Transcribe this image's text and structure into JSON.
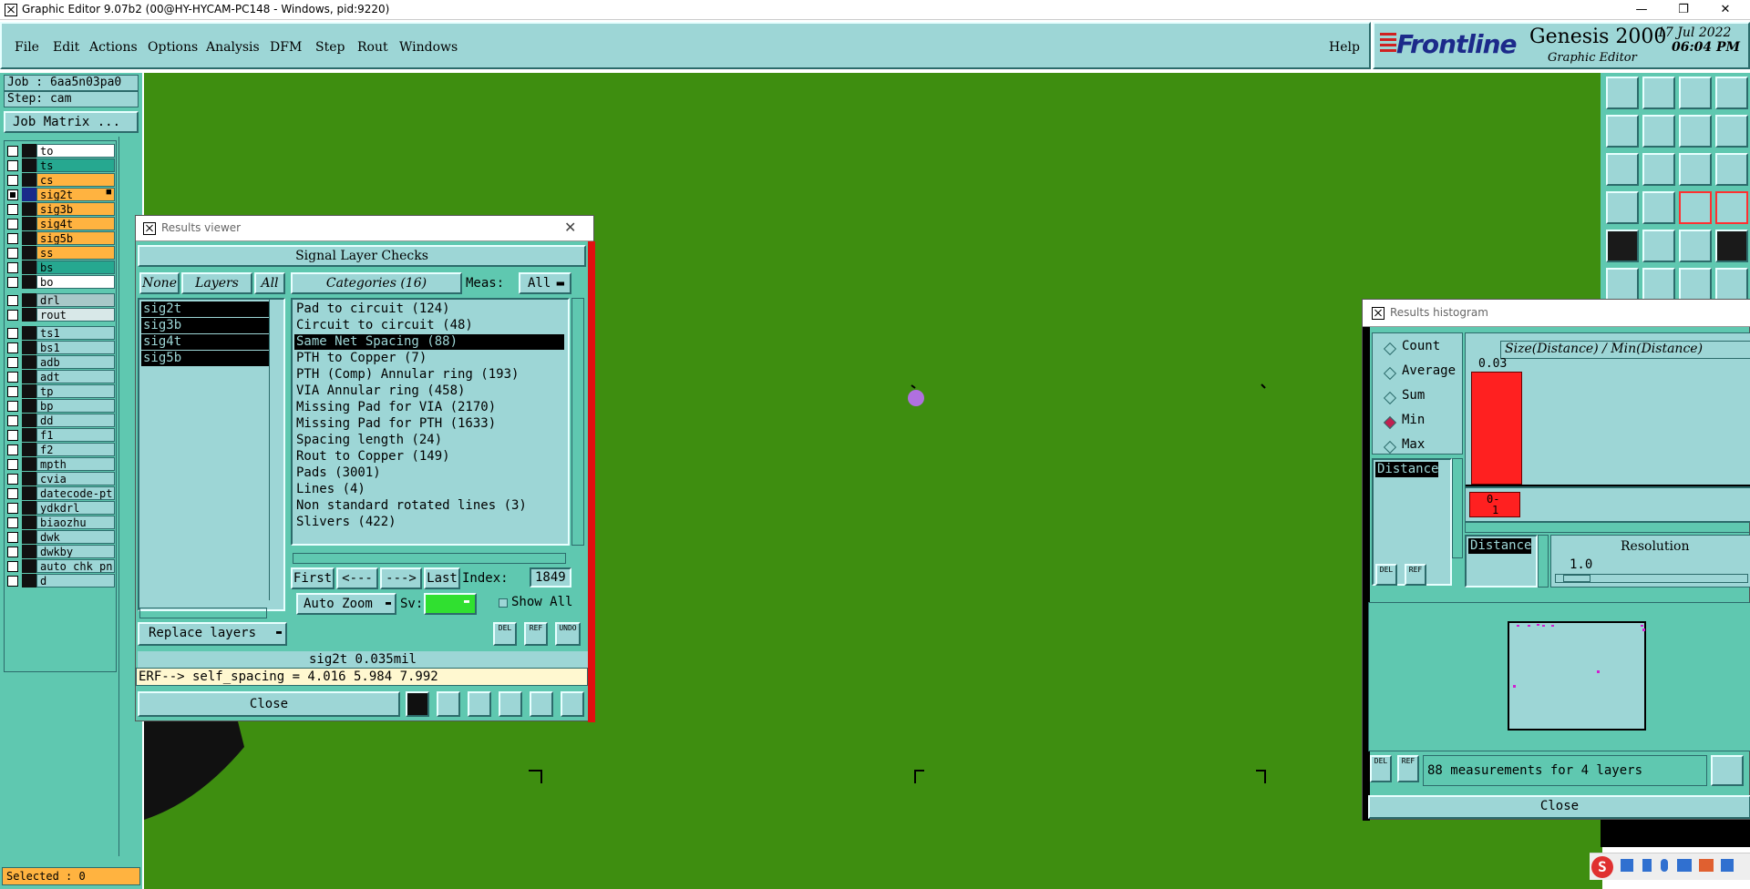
{
  "window": {
    "title": "Graphic Editor 9.07b2 (00@HY-HYCAM-PC148 - Windows, pid:9220)"
  },
  "menu": [
    "File",
    "Edit",
    "Actions",
    "Options",
    "Analysis",
    "DFM",
    "Step",
    "Rout",
    "Windows"
  ],
  "menu_help": "Help",
  "brand": {
    "logo": "Frontline",
    "product": "Genesis 2000",
    "sub": "Graphic Editor",
    "date": "17 Jul 2022",
    "time": "06:04 PM"
  },
  "job": {
    "job_label": "Job : 6aa5n03pa0",
    "step_label": "Step: cam",
    "matrix_button": "Job Matrix ..."
  },
  "layers_group1": [
    {
      "name": "to",
      "color": "#ffffff",
      "on": false
    },
    {
      "name": "ts",
      "color": "#26a890",
      "on": false
    },
    {
      "name": "cs",
      "color": "#ffb340",
      "on": false
    },
    {
      "name": "sig2t",
      "color": "#ffb340",
      "on": true,
      "extra": "■"
    },
    {
      "name": "sig3b",
      "color": "#ffb340",
      "on": false
    },
    {
      "name": "sig4t",
      "color": "#ffb340",
      "on": false
    },
    {
      "name": "sig5b",
      "color": "#ffb340",
      "on": false
    },
    {
      "name": "ss",
      "color": "#ffb340",
      "on": false
    },
    {
      "name": "bs",
      "color": "#26a890",
      "on": false
    },
    {
      "name": "bo",
      "color": "#ffffff",
      "on": false
    }
  ],
  "layers_group2": [
    {
      "name": "drl",
      "color": "#a8c8c8"
    },
    {
      "name": "rout",
      "color": "#d8e8e8"
    }
  ],
  "layers_group3": [
    "ts1",
    "bs1",
    "adb",
    "adt",
    "tp",
    "bp",
    "dd",
    "f1",
    "f2",
    "mpth",
    "cvia",
    "datecode-pt",
    "ydkdrl",
    "biaozhu",
    "dwk",
    "dwkby",
    "auto_chk_pn",
    "d"
  ],
  "selected_label": "Selected : 0",
  "results_viewer": {
    "title": "Results viewer",
    "header": "Signal Layer Checks",
    "none_btn": "None",
    "layers_btn": "Layers",
    "all_btn": "All",
    "categories_btn": "Categories (16)",
    "meas_label": "Meas:",
    "meas_value": "All",
    "layers": [
      "sig2t",
      "sig3b",
      "sig4t",
      "sig5b"
    ],
    "categories": [
      "Pad to circuit (124)",
      "Circuit to circuit (48)",
      "Same Net Spacing (88)",
      "PTH to Copper (7)",
      "PTH (Comp) Annular ring (193)",
      "VIA Annular ring (458)",
      "Missing Pad for VIA (2170)",
      "Missing Pad for PTH (1633)",
      "Spacing length (24)",
      "Rout to Copper (149)",
      "Pads (3001)",
      "Lines (4)",
      "Non standard rotated lines (3)",
      "Slivers (422)"
    ],
    "selected_category_index": 2,
    "first_btn": "First",
    "prev_btn": "<---",
    "next_btn": "--->",
    "last_btn": "Last",
    "index_label": "Index:",
    "index_value": "1849",
    "autozoom": "Auto Zoom",
    "sv_label": "Sv:",
    "show_all": "Show All",
    "replace_layers": "Replace layers",
    "del": "DEL",
    "ref": "REF",
    "undo": "UNDO",
    "status_line": "sig2t 0.035mil",
    "erf_line": "ERF--> self_spacing = 4.016 5.984 7.992",
    "close": "Close"
  },
  "histogram": {
    "title": "Results histogram",
    "options": [
      "Count",
      "Average",
      "Sum",
      "Min",
      "Max"
    ],
    "selected_option": "Min",
    "axis_title": "Size(Distance) / Min(Distance)",
    "bar_label": "0.03",
    "low_label": "0-",
    "low_label2": "1",
    "list_item": "Distance",
    "list_item2": "Distance",
    "resolution_label": "Resolution",
    "resolution_value": "1.0",
    "del": "DEL",
    "ref": "REF",
    "summary": "88 measurements for 4 layers",
    "close": "Close",
    "colors": {
      "bar": "#ff2020",
      "point": "#d020d0"
    }
  }
}
